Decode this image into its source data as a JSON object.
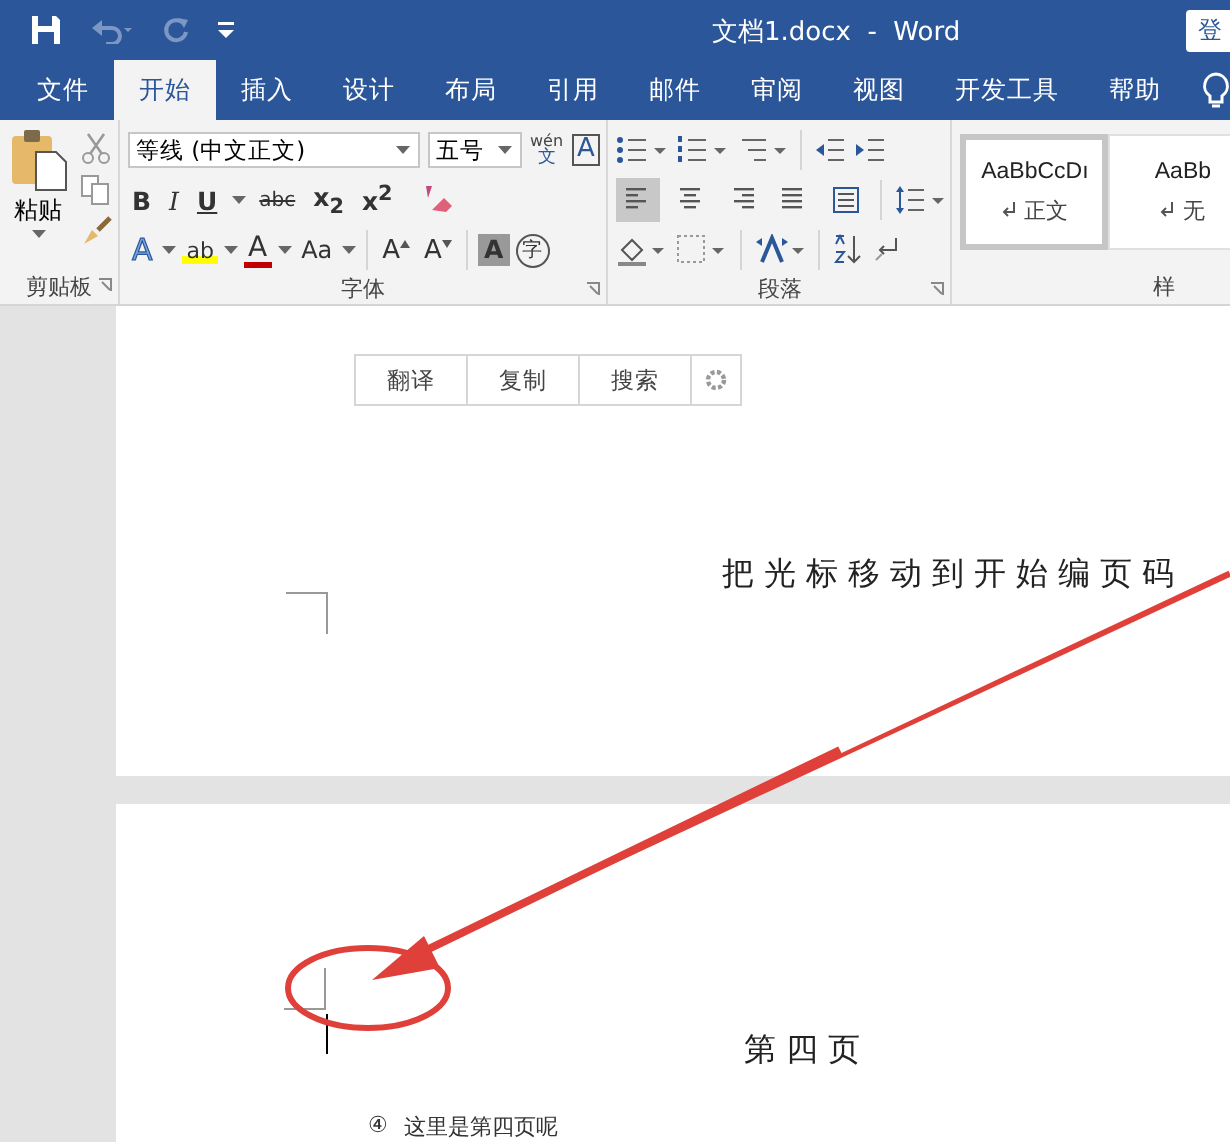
{
  "window": {
    "title": "文档1.docx  -  Word",
    "account_button": "登"
  },
  "tabs": [
    {
      "label": "文件",
      "selected": false
    },
    {
      "label": "开始",
      "selected": true
    },
    {
      "label": "插入",
      "selected": false
    },
    {
      "label": "设计",
      "selected": false
    },
    {
      "label": "布局",
      "selected": false
    },
    {
      "label": "引用",
      "selected": false
    },
    {
      "label": "邮件",
      "selected": false
    },
    {
      "label": "审阅",
      "selected": false
    },
    {
      "label": "视图",
      "selected": false
    },
    {
      "label": "开发工具",
      "selected": false
    },
    {
      "label": "帮助",
      "selected": false
    }
  ],
  "ribbon": {
    "clipboard": {
      "paste_label": "粘贴",
      "group_label": "剪贴板"
    },
    "font": {
      "font_name": "等线 (中文正文)",
      "font_size": "五号",
      "phonetic_top": "wén",
      "phonetic_bottom": "文",
      "border_glyph": "A",
      "format_buttons": [
        {
          "glyph": "B",
          "kind": "bold"
        },
        {
          "glyph": "I",
          "kind": "italic"
        },
        {
          "glyph": "U",
          "kind": "underline"
        },
        {
          "glyph": "abc",
          "kind": "strike"
        },
        {
          "glyph": "x$_{2}$",
          "kind": "script"
        },
        {
          "glyph": "x$^{2}$",
          "kind": "script"
        }
      ],
      "effect_buttons": [
        {
          "glyph": "A",
          "kind": "effect"
        },
        {
          "glyph": "ab",
          "kind": "highlight"
        },
        {
          "glyph": "A",
          "kind": "color"
        },
        {
          "glyph": "Aa",
          "kind": "case"
        },
        {
          "glyph": "A",
          "kind": "grow"
        },
        {
          "glyph": "A",
          "kind": "shrink"
        },
        {
          "glyph": "A",
          "kind": "shading"
        },
        {
          "glyph": "字",
          "kind": "enclose"
        }
      ],
      "group_label": "字体"
    },
    "paragraph": {
      "alignments": [
        {
          "kind": "left",
          "selected": true
        },
        {
          "kind": "center",
          "selected": false
        },
        {
          "kind": "right",
          "selected": false
        },
        {
          "kind": "justify",
          "selected": false
        },
        {
          "kind": "distributed",
          "selected": false
        }
      ],
      "group_label": "段落"
    },
    "styles": {
      "items": [
        {
          "preview": "AaBbCcDı",
          "name": "正文",
          "selected": true
        },
        {
          "preview": "AaBb",
          "name": "无",
          "selected": false
        }
      ],
      "group_label": "样"
    }
  },
  "document": {
    "toolbar": [
      {
        "label": "翻译"
      },
      {
        "label": "复制"
      },
      {
        "label": "搜索"
      }
    ],
    "instruction": "把光标移动到开始编页码",
    "heading": "第 四 页",
    "list_item": {
      "marker": "④",
      "text": "这里是第四页呢"
    }
  }
}
